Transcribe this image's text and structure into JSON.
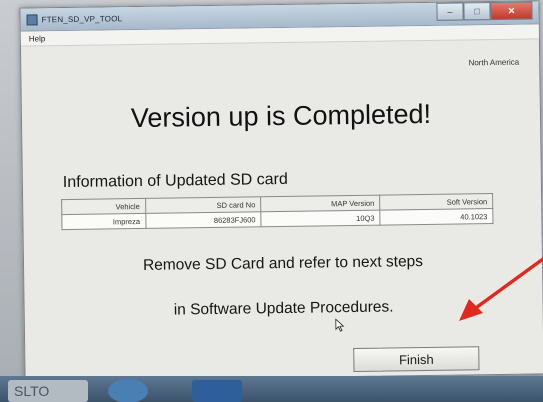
{
  "window": {
    "title": "FTEN_SD_VP_TOOL",
    "minimize_label": "–",
    "maximize_label": "□",
    "close_label": "✕"
  },
  "menu": {
    "help_label": "Help"
  },
  "region": "North America",
  "heading": "Version up is Completed!",
  "info_label": "Information of  Updated SD card",
  "table": {
    "headers": [
      "Vehicle",
      "SD card No",
      "MAP Version",
      "Soft Version"
    ],
    "row": [
      "Impreza",
      "86283FJ600",
      "10Q3",
      "40.1023"
    ]
  },
  "message_line1": "Remove SD Card and refer to next steps",
  "message_line2": "in Software Update Procedures.",
  "finish_label": "Finish",
  "taskbar": {
    "item1_label": "SLTO"
  },
  "colors": {
    "arrow": "#e0281e",
    "close_button": "#c0392b"
  }
}
